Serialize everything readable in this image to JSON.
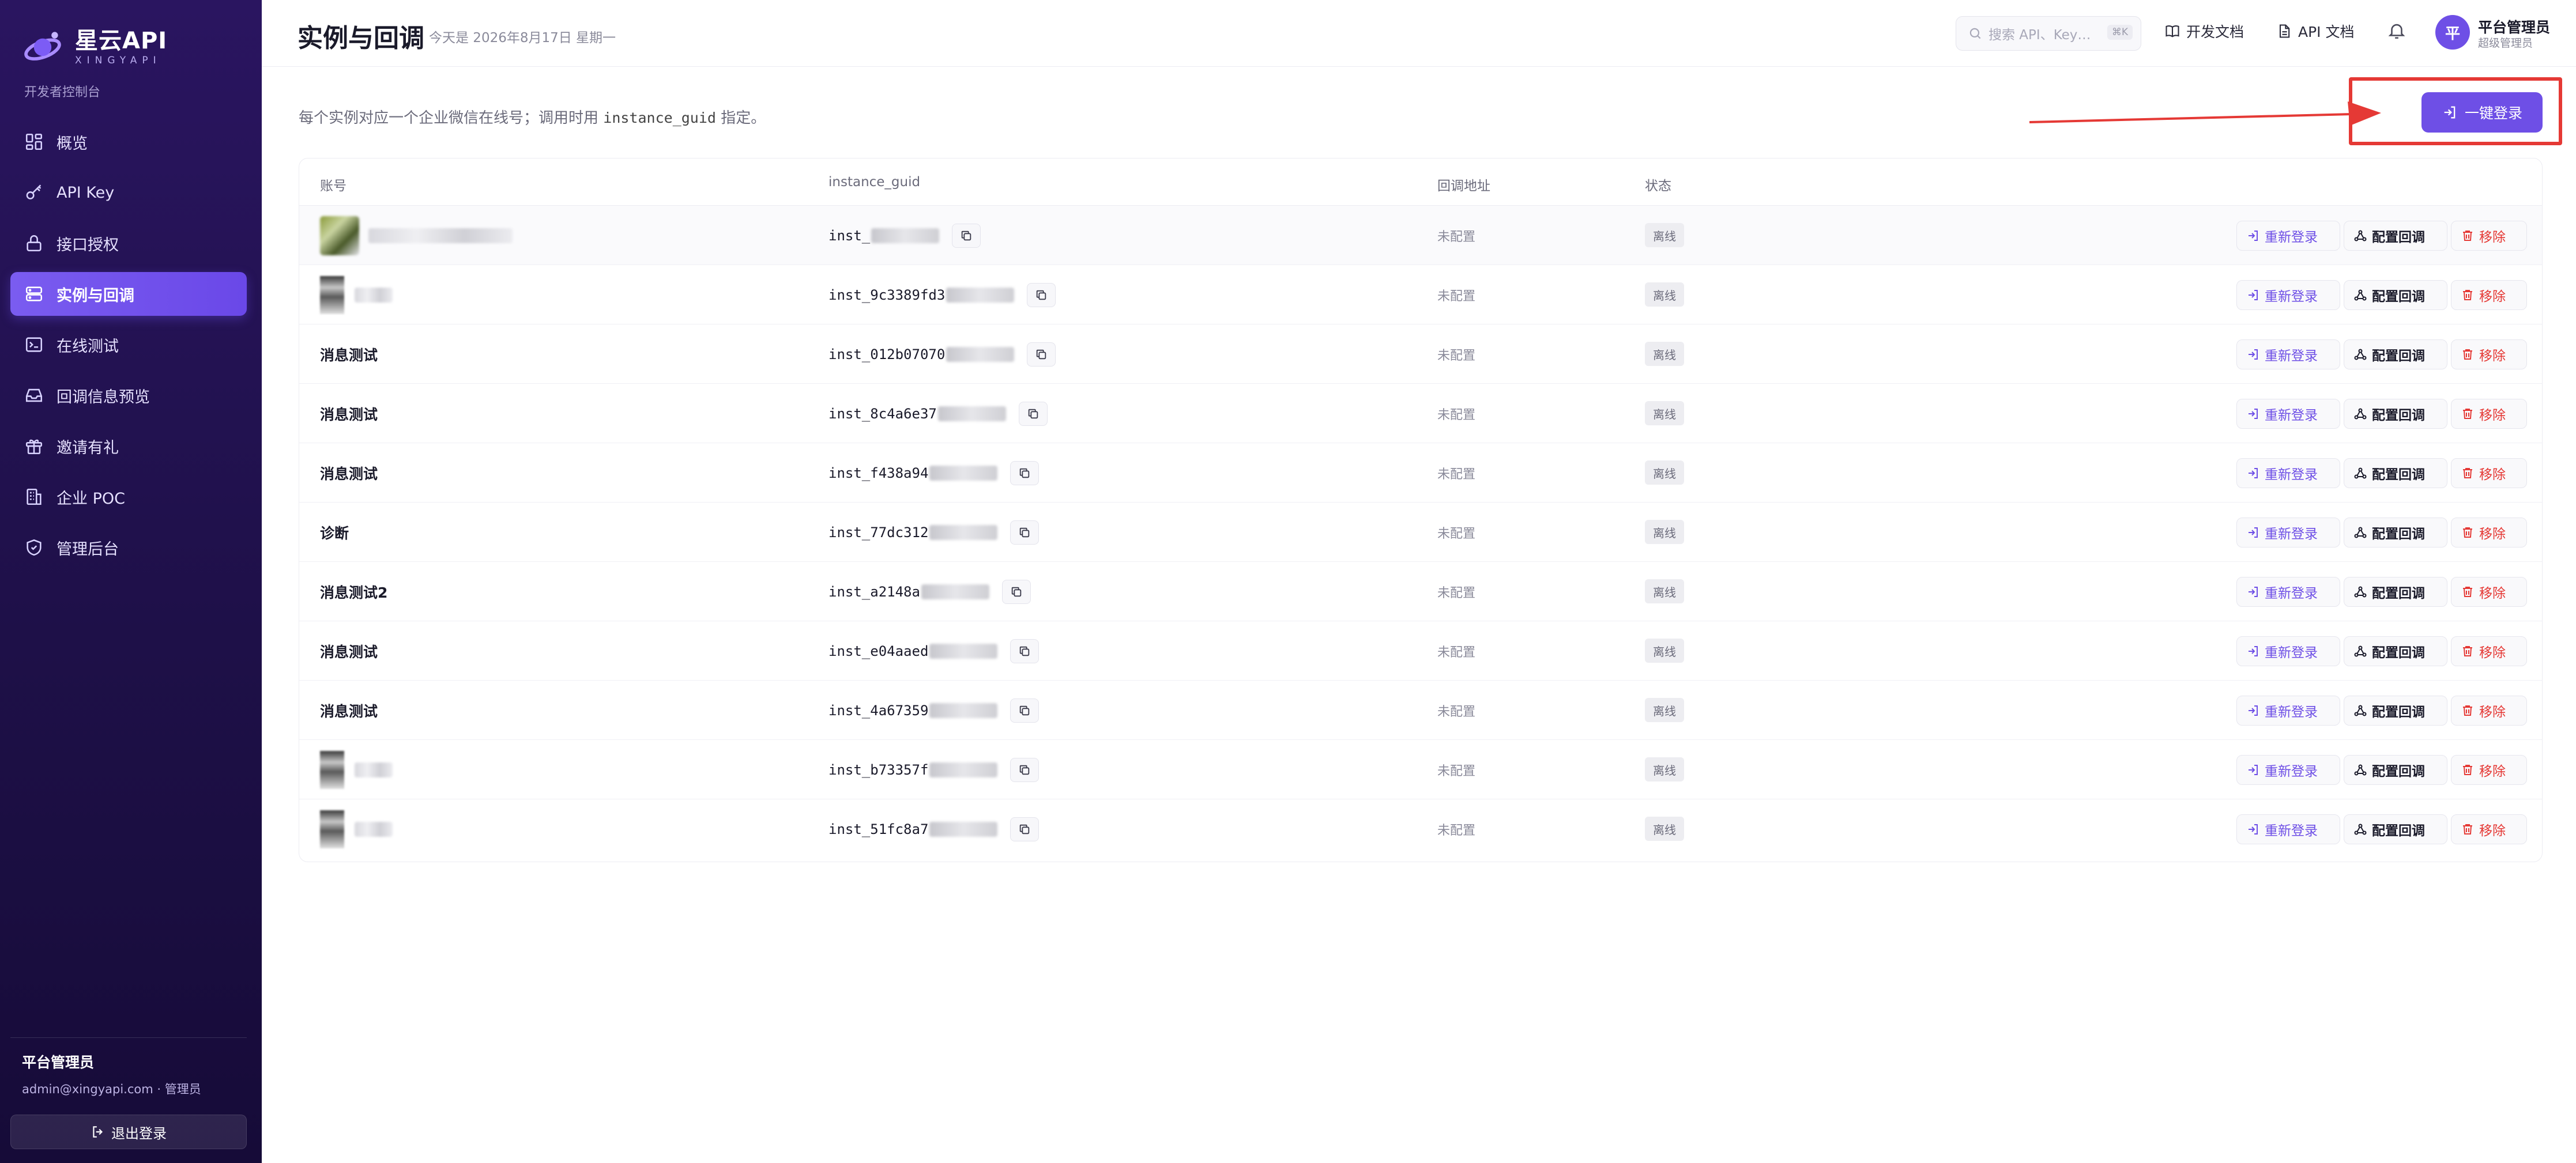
{
  "sidebar": {
    "brand_name": "星云API",
    "brand_sub": "XINGYAPI",
    "console_label": "开发者控制台",
    "items": [
      {
        "label": "概览",
        "icon": "dashboard-icon"
      },
      {
        "label": "API Key",
        "icon": "key-icon"
      },
      {
        "label": "接口授权",
        "icon": "lock-icon"
      },
      {
        "label": "实例与回调",
        "icon": "server-icon",
        "active": true
      },
      {
        "label": "在线测试",
        "icon": "terminal-icon"
      },
      {
        "label": "回调信息预览",
        "icon": "inbox-icon"
      },
      {
        "label": "邀请有礼",
        "icon": "gift-icon"
      },
      {
        "label": "企业 POC",
        "icon": "building-icon"
      },
      {
        "label": "管理后台",
        "icon": "shield-icon"
      }
    ],
    "user_name": "平台管理员",
    "user_email": "admin@xingyapi.com · 管理员",
    "logout_label": "退出登录"
  },
  "header": {
    "title": "实例与回调",
    "date": "今天是 2026年8月17日 星期一",
    "search_placeholder": "搜索 API、Key…",
    "search_shortcut": "⌘K",
    "dev_docs": "开发文档",
    "api_docs": "API 文档",
    "avatar_initial": "平",
    "user_name": "平台管理员",
    "user_role": "超级管理员"
  },
  "main": {
    "desc_prefix": "每个实例对应一个企业微信在线号；调用时用",
    "desc_code": "instance_guid",
    "desc_suffix": "指定。",
    "login_button": "一键登录",
    "accent_color": "#6e4fe6",
    "annotation_color": "#e53935"
  },
  "table": {
    "columns": [
      "账号",
      "instance_guid",
      "回调地址",
      "状态"
    ],
    "actions": {
      "relogin": "重新登录",
      "configure": "配置回调",
      "remove": "移除"
    },
    "rows": [
      {
        "account": "",
        "account_type": "avatar-blurred",
        "guid": "inst_",
        "callback": "未配置",
        "status": "离线"
      },
      {
        "account": "",
        "account_type": "pixel-blurred",
        "guid": "inst_9c3389fd3",
        "callback": "未配置",
        "status": "离线"
      },
      {
        "account": "消息测试",
        "account_type": "text",
        "guid": "inst_012b07070",
        "callback": "未配置",
        "status": "离线"
      },
      {
        "account": "消息测试",
        "account_type": "text",
        "guid": "inst_8c4a6e37",
        "callback": "未配置",
        "status": "离线"
      },
      {
        "account": "消息测试",
        "account_type": "text",
        "guid": "inst_f438a94",
        "callback": "未配置",
        "status": "离线"
      },
      {
        "account": "诊断",
        "account_type": "text",
        "guid": "inst_77dc312",
        "callback": "未配置",
        "status": "离线"
      },
      {
        "account": "消息测试2",
        "account_type": "text",
        "guid": "inst_a2148a",
        "callback": "未配置",
        "status": "离线"
      },
      {
        "account": "消息测试",
        "account_type": "text",
        "guid": "inst_e04aaed",
        "callback": "未配置",
        "status": "离线"
      },
      {
        "account": "消息测试",
        "account_type": "text",
        "guid": "inst_4a67359",
        "callback": "未配置",
        "status": "离线"
      },
      {
        "account": "",
        "account_type": "pixel-blurred",
        "guid": "inst_b73357f",
        "callback": "未配置",
        "status": "离线"
      },
      {
        "account": "",
        "account_type": "pixel-blurred",
        "guid": "inst_51fc8a7",
        "callback": "未配置",
        "status": "离线"
      }
    ]
  }
}
